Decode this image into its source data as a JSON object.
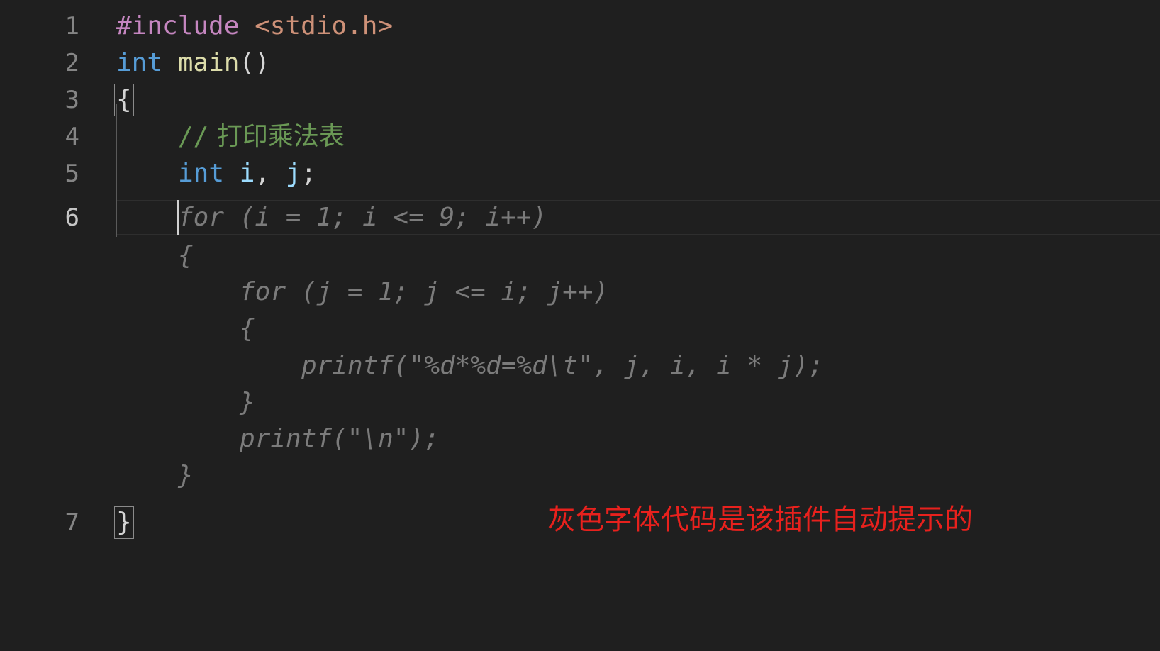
{
  "editor": {
    "language": "c",
    "active_line": "6",
    "line_numbers": [
      "1",
      "2",
      "3",
      "4",
      "5",
      "6",
      "7"
    ],
    "lines": {
      "l1": {
        "directive": "#include",
        "header": "<stdio.h>"
      },
      "l2": {
        "type": "int",
        "name": "main",
        "parens": "()"
      },
      "l3": {
        "brace": "{"
      },
      "l4": {
        "comment_slashes": "//",
        "comment_text": "打印乘法表"
      },
      "l5": {
        "type": "int",
        "var_i": "i",
        "sep": ",",
        "var_j": "j",
        "end": ";"
      },
      "l7": {
        "brace": "}"
      }
    },
    "suggestion": {
      "lines": [
        "for (i = 1; i <= 9; i++)",
        "{",
        "for (j = 1; j <= i; j++)",
        "{",
        "printf(\"%d*%d=%d\\t\", j, i, i * j);",
        "}",
        "printf(\"\\n\");",
        "}"
      ]
    }
  },
  "annotation": {
    "text": "灰色字体代码是该插件自动提示的",
    "color": "#e8211d"
  },
  "colors": {
    "background": "#1f1f1f",
    "keyword_preprocessor": "#c586c0",
    "string": "#ce9178",
    "type": "#569cd6",
    "function": "#dcdcaa",
    "variable": "#9cdcfe",
    "comment": "#6a9955",
    "ghost_text": "#7b7b7b"
  }
}
